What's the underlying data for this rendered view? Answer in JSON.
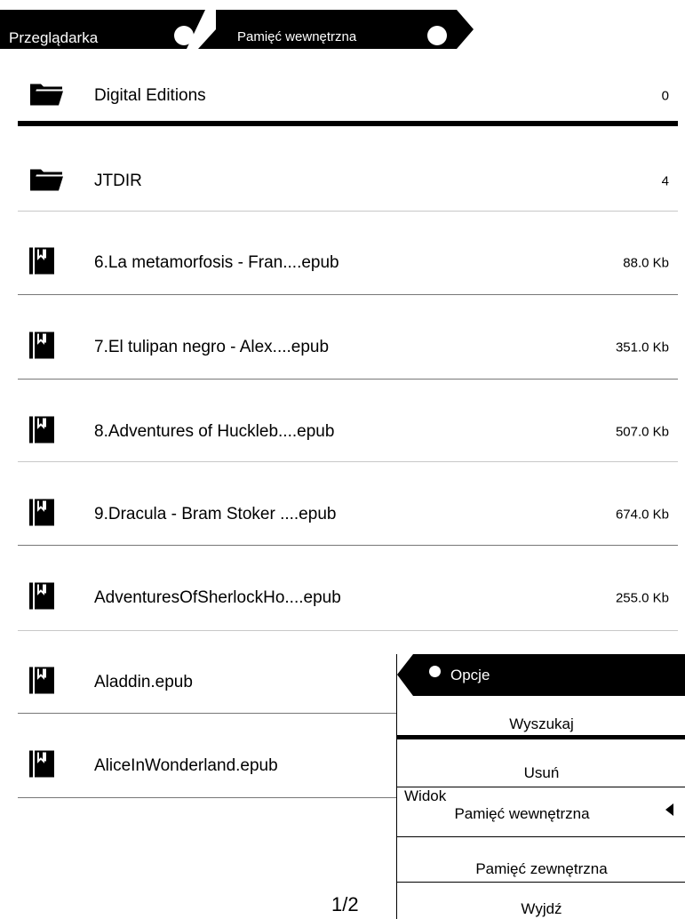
{
  "breadcrumb": {
    "items": [
      "Przeglądarka",
      "Pamięć wewnętrzna"
    ]
  },
  "files": [
    {
      "name": "Digital Editions",
      "size": "0",
      "type": "folder",
      "icon": "folder-icon"
    },
    {
      "name": "JTDIR",
      "size": "4",
      "type": "folder",
      "icon": "folder-icon"
    },
    {
      "name": "6.La metamorfosis - Fran....epub",
      "size": "88.0 Kb",
      "type": "book",
      "icon": "book-icon"
    },
    {
      "name": "7.El tulipan negro - Alex....epub",
      "size": "351.0 Kb",
      "type": "book",
      "icon": "book-icon"
    },
    {
      "name": "8.Adventures of Huckleb....epub",
      "size": "507.0 Kb",
      "type": "book",
      "icon": "book-icon"
    },
    {
      "name": "9.Dracula - Bram Stoker ....epub",
      "size": "674.0 Kb",
      "type": "book",
      "icon": "book-icon"
    },
    {
      "name": "AdventuresOfSherlockHo....epub",
      "size": "255.0 Kb",
      "type": "book",
      "icon": "book-icon"
    },
    {
      "name": "Aladdin.epub",
      "size": "",
      "type": "book",
      "icon": "book-icon"
    },
    {
      "name": "AliceInWonderland.epub",
      "size": "",
      "type": "book",
      "icon": "book-icon"
    }
  ],
  "pagination": {
    "label": "1/2"
  },
  "menu": {
    "title": "Opcje",
    "search": "Wyszukaj",
    "delete": "Usuń",
    "view_label": "Widok",
    "view_value": "Pamięć wewnętrzna",
    "external": "Pamięć zewnętrzna",
    "exit": "Wyjdź"
  },
  "colors": {
    "ink": "#000000",
    "paper": "#ffffff",
    "divider": "#777777"
  }
}
